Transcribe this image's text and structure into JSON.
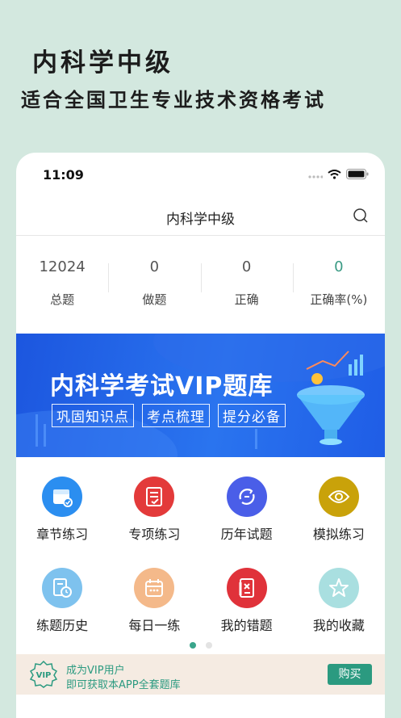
{
  "hero": {
    "title": "内科学中级",
    "subtitle": "适合全国卫生专业技术资格考试"
  },
  "status_bar": {
    "time": "11:09"
  },
  "nav": {
    "title": "内科学中级",
    "search_icon": "search-icon"
  },
  "stats": [
    {
      "value": "12024",
      "label": "总题"
    },
    {
      "value": "0",
      "label": "做题"
    },
    {
      "value": "0",
      "label": "正确"
    },
    {
      "value": "0",
      "label": "正确率(%)"
    }
  ],
  "banner": {
    "title": "内科学考试VIP题库",
    "tags": [
      "巩固知识点",
      "考点梳理",
      "提分必备"
    ]
  },
  "menu": [
    {
      "label": "章节练习",
      "icon": "calendar-check-icon",
      "color": "#2b8ef0"
    },
    {
      "label": "专项练习",
      "icon": "checklist-icon",
      "color": "#e33a3a"
    },
    {
      "label": "历年试题",
      "icon": "history-sync-icon",
      "color": "#4a5ee8"
    },
    {
      "label": "模拟练习",
      "icon": "eye-icon",
      "color": "#c9a20a"
    },
    {
      "label": "练题历史",
      "icon": "document-clock-icon",
      "color": "#7ec2ee"
    },
    {
      "label": "每日一练",
      "icon": "calendar-icon",
      "color": "#f4b98a"
    },
    {
      "label": "我的错题",
      "icon": "error-book-icon",
      "color": "#e0323a"
    },
    {
      "label": "我的收藏",
      "icon": "star-icon",
      "color": "#a9dfe0"
    }
  ],
  "pager": {
    "current": 1,
    "total": 2
  },
  "vip": {
    "badge": "VIP",
    "line1": "成为VIP用户",
    "line2": "即可获取本APP全套题库",
    "button": "购买"
  },
  "colors": {
    "accent": "#2b9a80",
    "background": "#d3e8df",
    "banner": "#1f5fe6"
  }
}
